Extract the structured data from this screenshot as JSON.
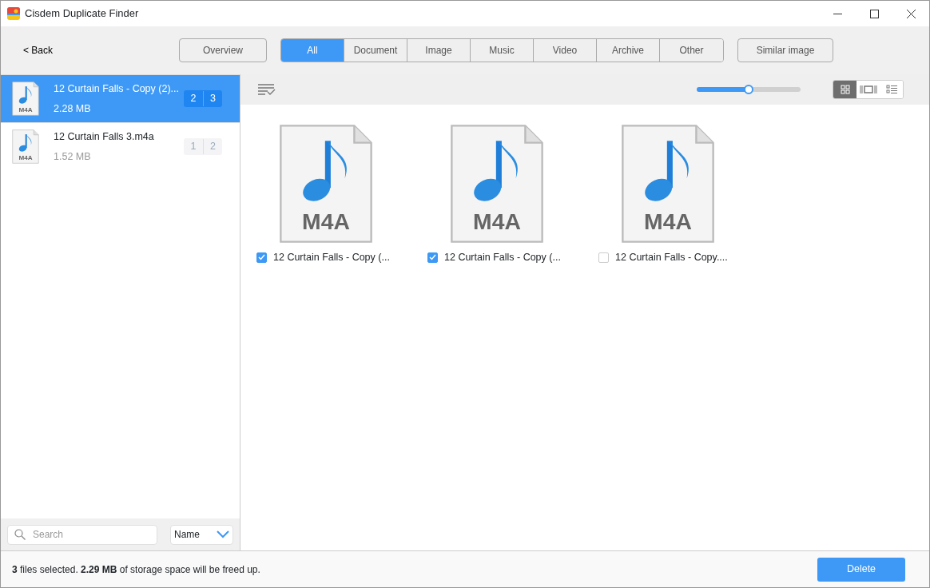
{
  "window": {
    "title": "Cisdem Duplicate Finder"
  },
  "toolbar": {
    "back": "< Back",
    "overview": "Overview",
    "similar": "Similar image",
    "tabs": [
      {
        "label": "All",
        "selected": true
      },
      {
        "label": "Document",
        "selected": false
      },
      {
        "label": "Image",
        "selected": false
      },
      {
        "label": "Music",
        "selected": false
      },
      {
        "label": "Video",
        "selected": false
      },
      {
        "label": "Archive",
        "selected": false
      },
      {
        "label": "Other",
        "selected": false
      }
    ]
  },
  "groups": [
    {
      "name": "12 Curtain Falls - Copy (2)...",
      "size": "2.28 MB",
      "icon_label": "M4A",
      "counts": [
        "2",
        "3"
      ],
      "selected": true
    },
    {
      "name": "12 Curtain Falls 3.m4a",
      "size": "1.52 MB",
      "icon_label": "M4A",
      "counts": [
        "1",
        "2"
      ],
      "selected": false
    }
  ],
  "search": {
    "placeholder": "Search"
  },
  "sort": {
    "value": "Name"
  },
  "zoom_slider": {
    "level": 0.5
  },
  "view_modes": [
    {
      "kind": "grid",
      "selected": true
    },
    {
      "kind": "filmstrip",
      "selected": false
    },
    {
      "kind": "list",
      "selected": false
    }
  ],
  "files": [
    {
      "name": "12 Curtain Falls - Copy (...",
      "icon_label": "M4A",
      "checked": true
    },
    {
      "name": "12 Curtain Falls - Copy (...",
      "icon_label": "M4A",
      "checked": true
    },
    {
      "name": "12 Curtain Falls - Copy....",
      "icon_label": "M4A",
      "checked": false
    }
  ],
  "status_bar": {
    "text": "**3**  files selected.  **2.29 MB**  of storage space will be freed up.",
    "delete": "Delete"
  }
}
